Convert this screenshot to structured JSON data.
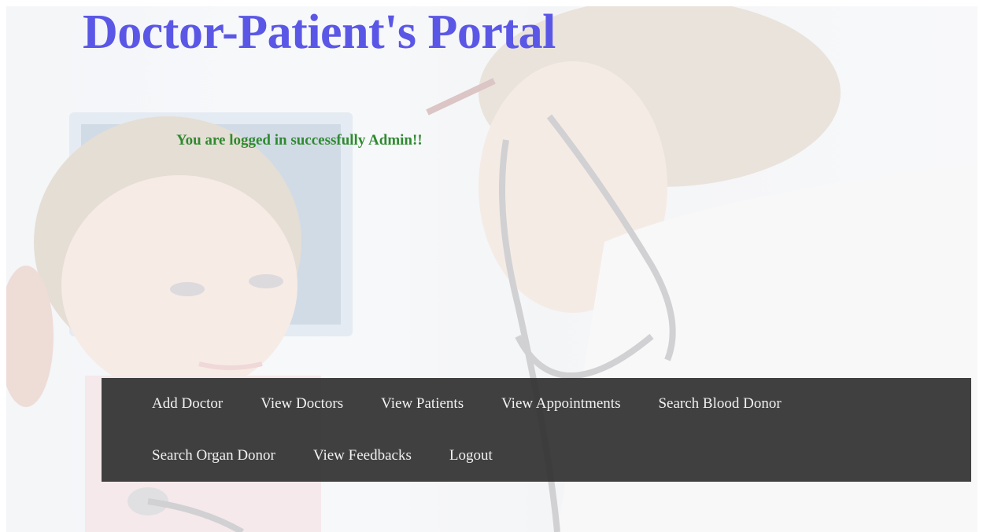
{
  "header": {
    "title": "Doctor-Patient's Portal"
  },
  "status": {
    "message": "You are logged in successfully Admin!!"
  },
  "nav": {
    "items": [
      {
        "label": "Add Doctor"
      },
      {
        "label": "View Doctors"
      },
      {
        "label": "View Patients"
      },
      {
        "label": "View Appointments"
      },
      {
        "label": "Search Blood Donor"
      },
      {
        "label": "Search Organ Donor"
      },
      {
        "label": "View Feedbacks"
      },
      {
        "label": "Logout"
      }
    ]
  },
  "colors": {
    "title": "#5b57e6",
    "status": "#2f8a2f",
    "navbar_bg": "#303030",
    "nav_text": "#f2f2f2"
  },
  "background_image": "doctor-examining-child-photo"
}
